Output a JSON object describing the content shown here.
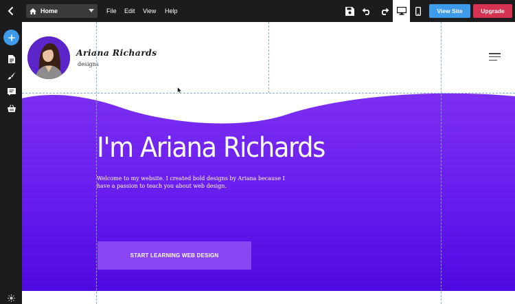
{
  "toolbar": {
    "page_selector": "Home",
    "menus": [
      "File",
      "Edit",
      "View",
      "Help"
    ],
    "view_site_label": "View Site",
    "upgrade_label": "Upgrade"
  },
  "site": {
    "logo_name": "Ariana Richards",
    "logo_sub": "designs",
    "hero_title": "I'm Ariana Richards",
    "hero_text": "Welcome to my website. I created bold designs by Ariana because I have a passion to teach you about web design.",
    "cta_label": "START LEARNING WEB DESIGN"
  },
  "colors": {
    "toolbar_bg": "#1c1c1e",
    "accent_blue": "#3d9be9",
    "upgrade_red": "#d63252",
    "hero_purple": "#6b1ff0",
    "cta_purple": "#8a45f2"
  }
}
